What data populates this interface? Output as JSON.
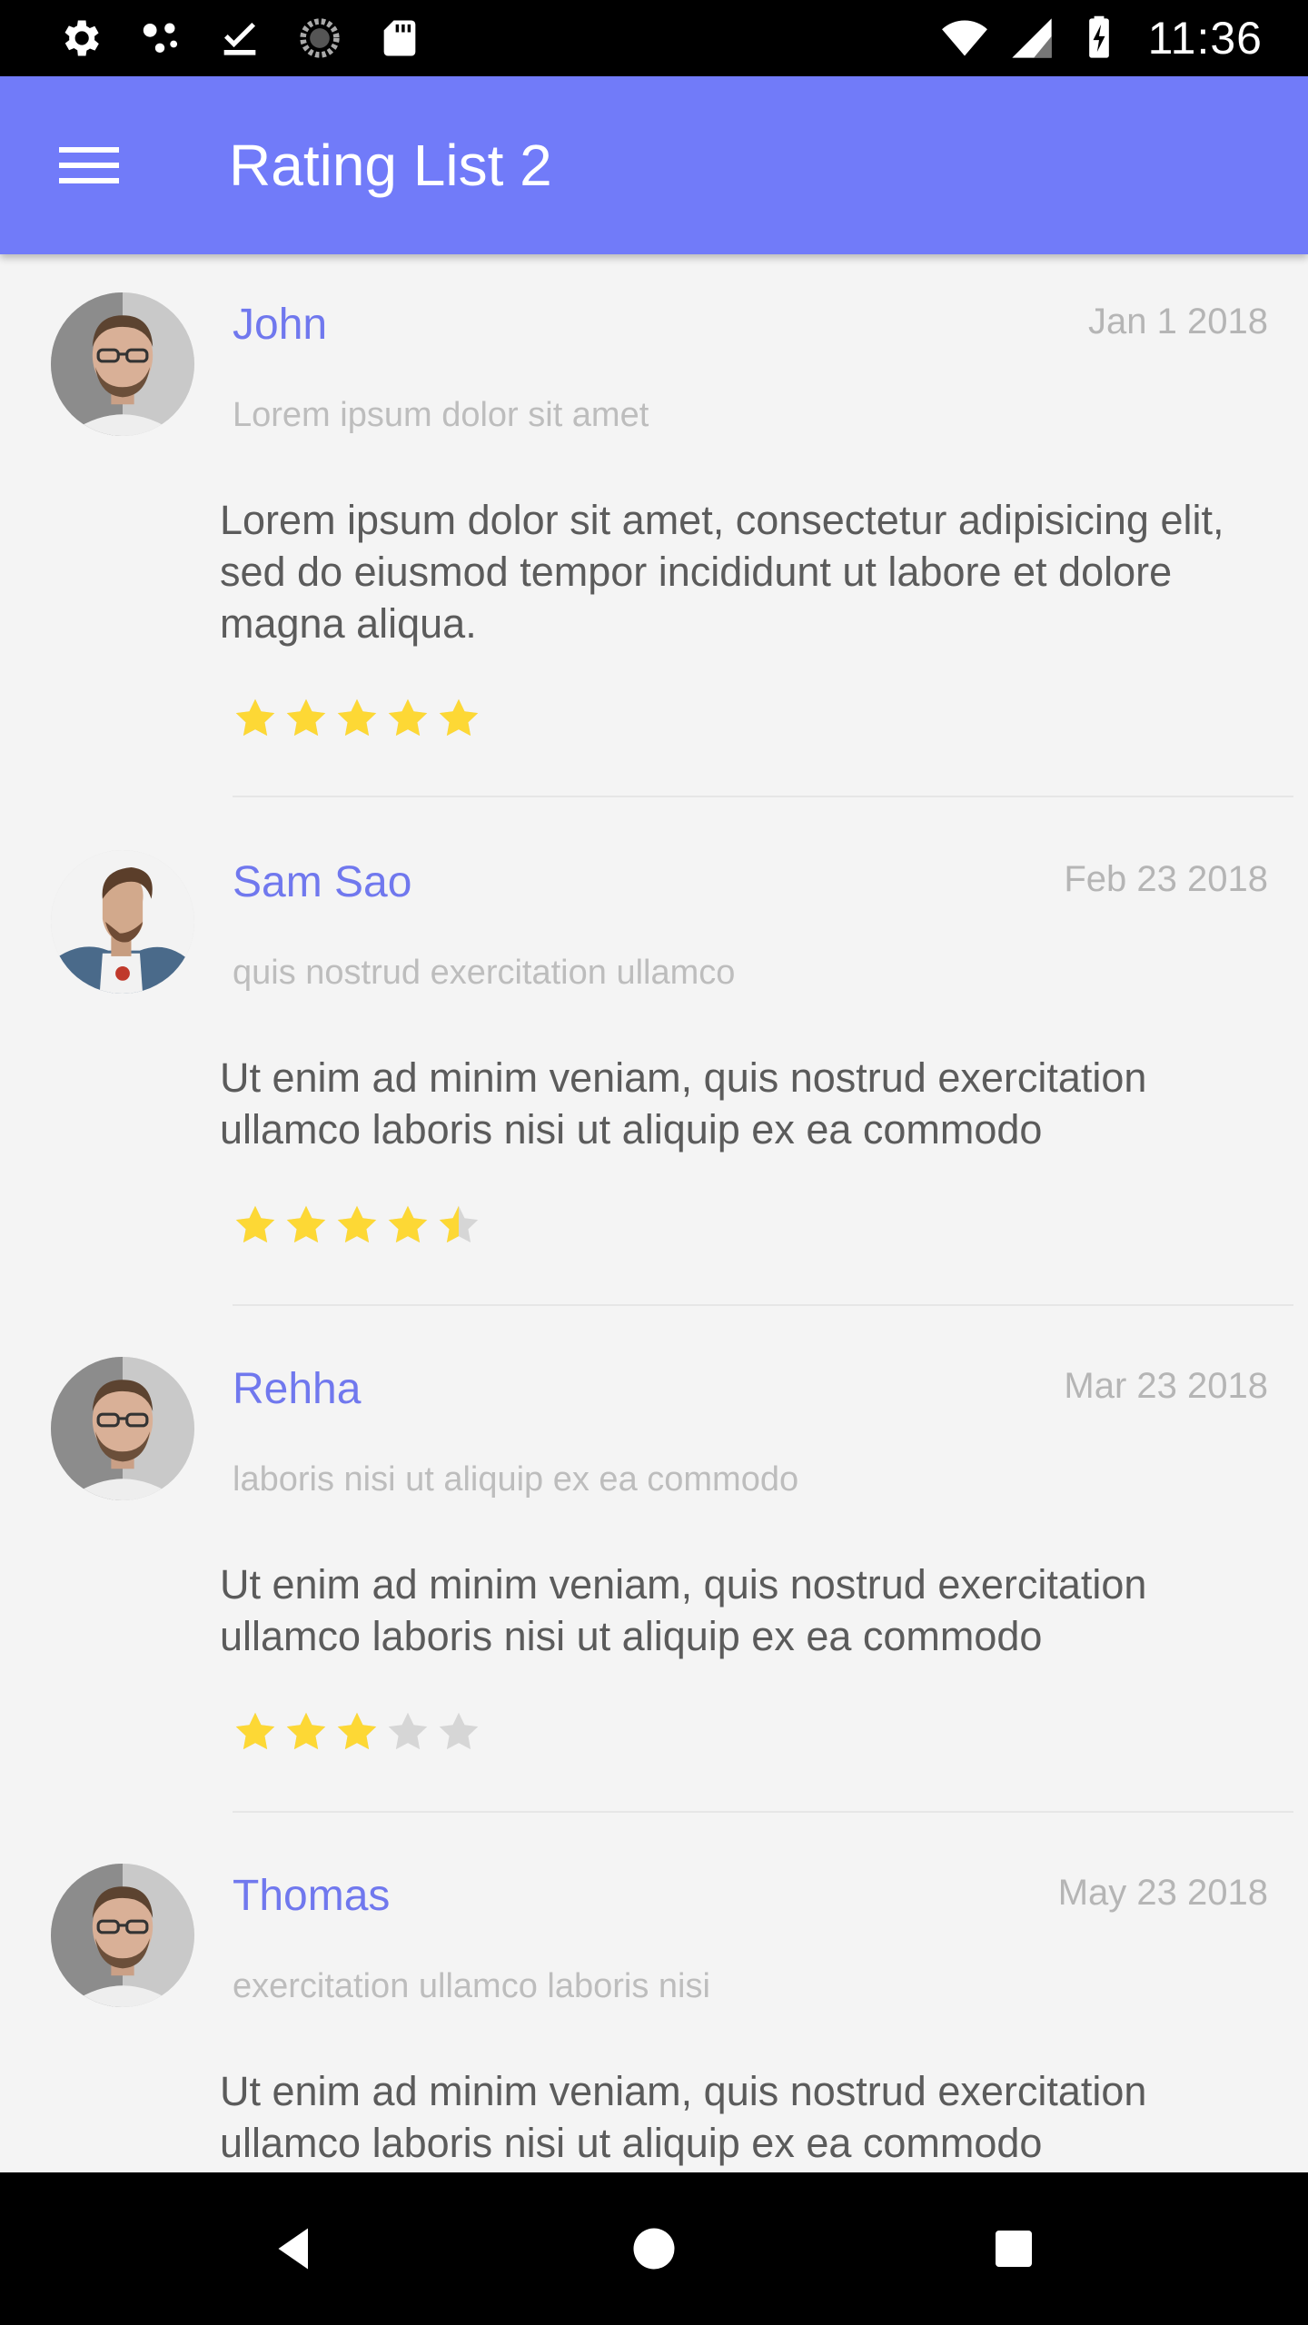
{
  "status_bar": {
    "time": "11:36",
    "left_icons": [
      "settings-icon",
      "dots-icon",
      "download-done-icon",
      "sync-icon",
      "sd-card-icon"
    ],
    "right_icons": [
      "wifi-icon",
      "signal-icon",
      "battery-charging-icon"
    ]
  },
  "app_bar": {
    "title": "Rating List 2",
    "menu_icon": "menu-icon"
  },
  "colors": {
    "primary": "#717bf9",
    "name": "#7078ee",
    "star_filled": "#fdd835",
    "star_empty": "#d6d6d6",
    "background": "#f4f4f4"
  },
  "reviews": [
    {
      "name": "John",
      "date": "Jan 1 2018",
      "subtitle": "Lorem ipsum dolor sit amet",
      "body": "Lorem ipsum dolor sit amet, consectetur adipisicing elit, sed do eiusmod tempor incididunt ut labore et dolore magna aliqua.",
      "rating": 5,
      "rating_max": 5
    },
    {
      "name": "Sam Sao",
      "date": "Feb 23 2018",
      "subtitle": "quis nostrud exercitation ullamco",
      "body": "Ut enim ad minim veniam, quis nostrud exercitation ullamco laboris nisi ut aliquip ex ea commodo",
      "rating": 4.5,
      "rating_max": 5
    },
    {
      "name": "Rehha",
      "date": "Mar 23 2018",
      "subtitle": "laboris nisi ut aliquip ex ea commodo",
      "body": "Ut enim ad minim veniam, quis nostrud exercitation ullamco laboris nisi ut aliquip ex ea commodo",
      "rating": 3,
      "rating_max": 5
    },
    {
      "name": "Thomas",
      "date": "May 23 2018",
      "subtitle": "exercitation ullamco laboris nisi",
      "body": "Ut enim ad minim veniam, quis nostrud exercitation ullamco laboris nisi ut aliquip ex ea commodo",
      "rating_max": 5
    }
  ],
  "nav_bar": {
    "buttons": [
      "back-icon",
      "home-icon",
      "recents-icon"
    ]
  }
}
